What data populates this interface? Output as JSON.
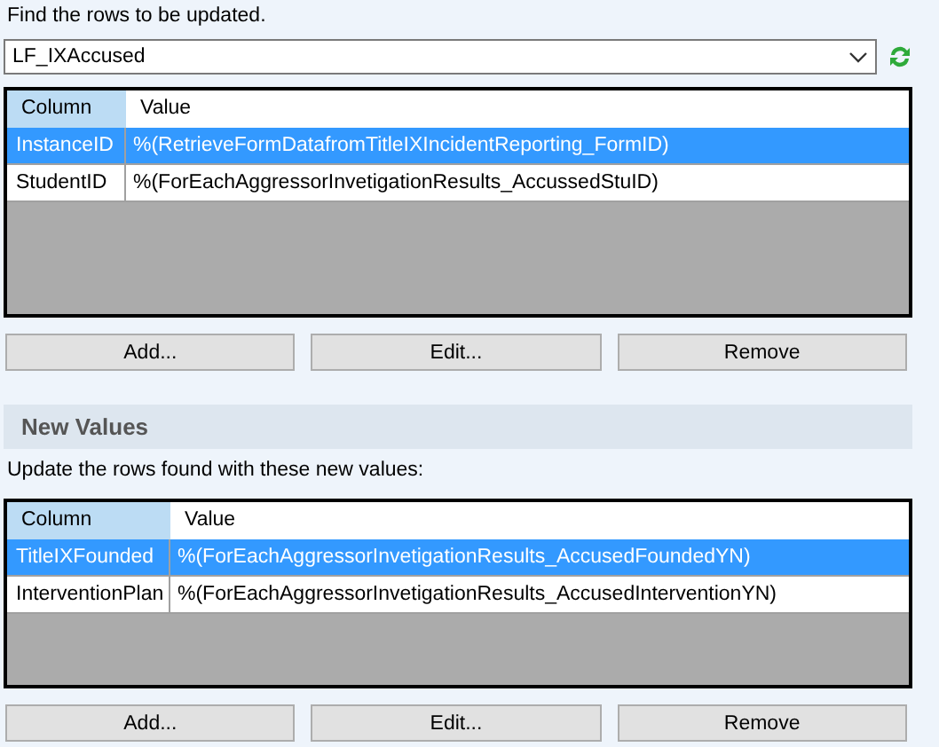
{
  "find_section": {
    "label": "Find the rows to be updated.",
    "dropdown": {
      "value": "LF_IXAccused"
    },
    "table": {
      "columns": [
        "Column",
        "Value"
      ],
      "rows": [
        {
          "column": "InstanceID",
          "value": "%(RetrieveFormDatafromTitleIXIncidentReporting_FormID)",
          "selected": true
        },
        {
          "column": "StudentID",
          "value": "%(ForEachAggressorInvetigationResults_AccussedStuID)",
          "selected": false
        }
      ]
    },
    "buttons": [
      "Add...",
      "Edit...",
      "Remove"
    ]
  },
  "new_values_section": {
    "title": "New Values",
    "label": "Update the rows found with these new values:",
    "table": {
      "columns": [
        "Column",
        "Value"
      ],
      "rows": [
        {
          "column": "TitleIXFounded",
          "value": "%(ForEachAggressorInvetigationResults_AccusedFoundedYN)",
          "selected": true
        },
        {
          "column": "InterventionPlan",
          "value": "%(ForEachAggressorInvetigationResults_AccusedInterventionYN)",
          "selected": false
        }
      ]
    },
    "buttons": [
      "Add...",
      "Edit...",
      "Remove"
    ]
  }
}
